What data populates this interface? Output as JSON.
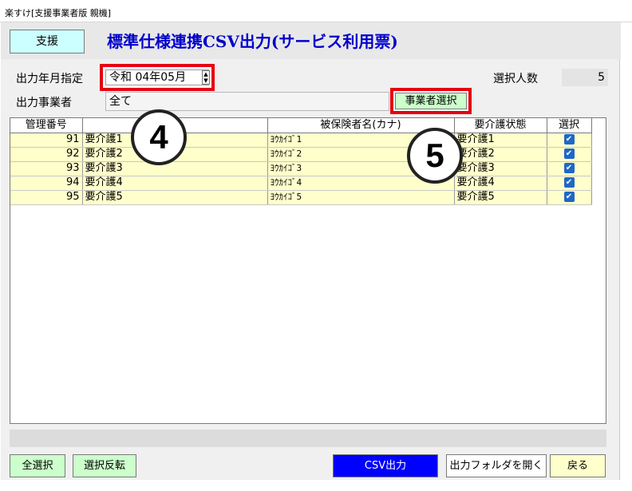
{
  "window": {
    "title": "楽すけ[支援事業者版 親機]"
  },
  "header": {
    "mode_badge": "支援",
    "title": "標準仕様連携CSV出力(サービス利用票)"
  },
  "filters": {
    "year_month_label": "出力年月指定",
    "year_month_value": "令和 04年05月",
    "provider_label": "出力事業者",
    "provider_value": "全て",
    "provider_button": "事業者選択",
    "selected_count_label": "選択人数",
    "selected_count_value": "5"
  },
  "table": {
    "columns": [
      "管理番号",
      "",
      "被保険者名(カナ)",
      "要介護状態",
      "選択"
    ],
    "rows": [
      {
        "id": "91",
        "name": "要介護1",
        "kana": "ﾖｳｶｲｺﾞ1",
        "care_level": "要介護1",
        "selected": true
      },
      {
        "id": "92",
        "name": "要介護2",
        "kana": "ﾖｳｶｲｺﾞ2",
        "care_level": "要介護2",
        "selected": true
      },
      {
        "id": "93",
        "name": "要介護3",
        "kana": "ﾖｳｶｲｺﾞ3",
        "care_level": "要介護3",
        "selected": true
      },
      {
        "id": "94",
        "name": "要介護4",
        "kana": "ﾖｳｶｲｺﾞ4",
        "care_level": "要介護4",
        "selected": true
      },
      {
        "id": "95",
        "name": "要介護5",
        "kana": "ﾖｳｶｲｺﾞ5",
        "care_level": "要介護5",
        "selected": true
      }
    ]
  },
  "buttons": {
    "select_all": "全選択",
    "invert_selection": "選択反転",
    "csv_output": "CSV出力",
    "open_folder": "出力フォルダを開く",
    "back": "戻る"
  },
  "callouts": {
    "c4": "4",
    "c5": "5"
  },
  "icons": {
    "spin_up": "spin-up-icon",
    "spin_down": "spin-down-icon",
    "checkbox": "checkbox-checked-icon"
  },
  "colors": {
    "title_text": "#0000cc",
    "mode_badge_bg": "#ccffff",
    "row_bg": "#ffffcc",
    "highlight_border": "#e60012",
    "csv_button_bg": "#0000ff",
    "green_button_bg": "#ccffcc",
    "back_button_bg": "#ffffcc",
    "checkbox": "#1e68c8"
  }
}
